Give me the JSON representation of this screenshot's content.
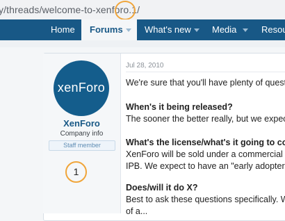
{
  "browser": {
    "url_fragment": "y/threads/welcome-to-xenforo.1/"
  },
  "nav": {
    "home": "Home",
    "forums": "Forums",
    "whats_new": "What's new",
    "media": "Media",
    "resources": "Resour"
  },
  "post": {
    "date": "Jul 28, 2010",
    "lines": [
      "We're sure that you'll have plenty of questio",
      "When's it being released?",
      "The sooner the better really, but we expect",
      "What's the license/what's it going to cost",
      "XenForo will be sold under a commercial lic",
      "IPB. We expect to have an \"early adopters\" s",
      "Does/will it do X?",
      "Best to ask these questions specifically. We",
      "of a..."
    ]
  },
  "user": {
    "avatar_text": "xenForo",
    "name": "XenForo",
    "title": "Company info",
    "badge": "Staff member"
  },
  "annotations": {
    "url_marker": "",
    "user_marker": "1"
  },
  "colors": {
    "nav_bg": "#185886",
    "accent": "#185886",
    "annotation": "#f0a53a"
  }
}
